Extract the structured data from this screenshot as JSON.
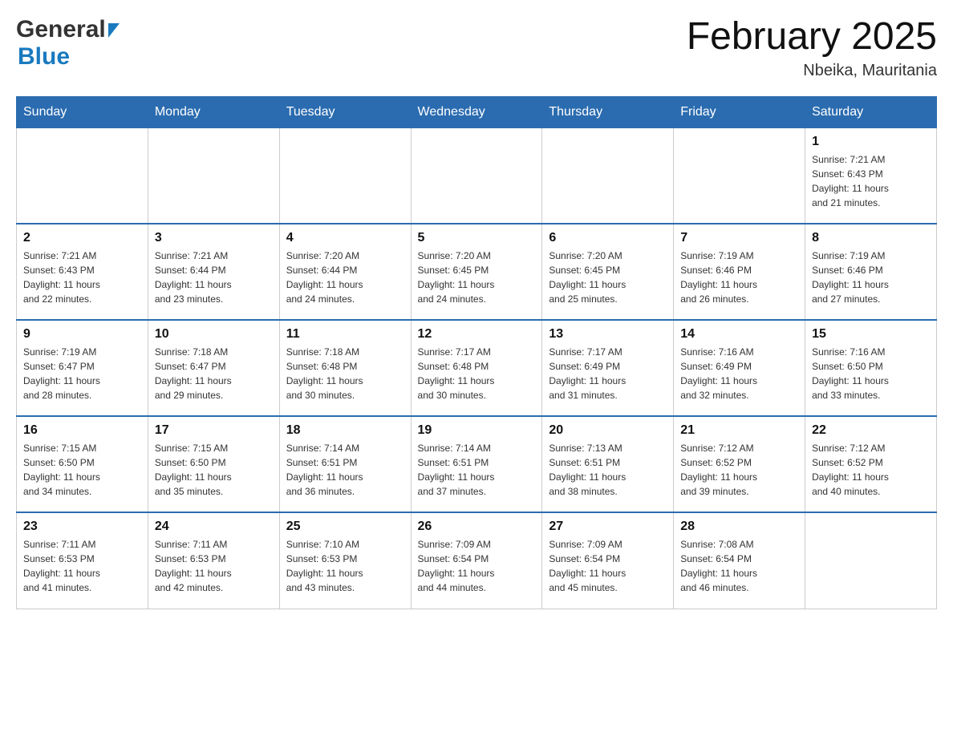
{
  "header": {
    "logo": {
      "general_text": "General",
      "blue_text": "Blue"
    },
    "title": "February 2025",
    "location": "Nbeika, Mauritania"
  },
  "calendar": {
    "days_of_week": [
      "Sunday",
      "Monday",
      "Tuesday",
      "Wednesday",
      "Thursday",
      "Friday",
      "Saturday"
    ],
    "weeks": [
      {
        "days": [
          {
            "number": "",
            "info": ""
          },
          {
            "number": "",
            "info": ""
          },
          {
            "number": "",
            "info": ""
          },
          {
            "number": "",
            "info": ""
          },
          {
            "number": "",
            "info": ""
          },
          {
            "number": "",
            "info": ""
          },
          {
            "number": "1",
            "info": "Sunrise: 7:21 AM\nSunset: 6:43 PM\nDaylight: 11 hours\nand 21 minutes."
          }
        ]
      },
      {
        "days": [
          {
            "number": "2",
            "info": "Sunrise: 7:21 AM\nSunset: 6:43 PM\nDaylight: 11 hours\nand 22 minutes."
          },
          {
            "number": "3",
            "info": "Sunrise: 7:21 AM\nSunset: 6:44 PM\nDaylight: 11 hours\nand 23 minutes."
          },
          {
            "number": "4",
            "info": "Sunrise: 7:20 AM\nSunset: 6:44 PM\nDaylight: 11 hours\nand 24 minutes."
          },
          {
            "number": "5",
            "info": "Sunrise: 7:20 AM\nSunset: 6:45 PM\nDaylight: 11 hours\nand 24 minutes."
          },
          {
            "number": "6",
            "info": "Sunrise: 7:20 AM\nSunset: 6:45 PM\nDaylight: 11 hours\nand 25 minutes."
          },
          {
            "number": "7",
            "info": "Sunrise: 7:19 AM\nSunset: 6:46 PM\nDaylight: 11 hours\nand 26 minutes."
          },
          {
            "number": "8",
            "info": "Sunrise: 7:19 AM\nSunset: 6:46 PM\nDaylight: 11 hours\nand 27 minutes."
          }
        ]
      },
      {
        "days": [
          {
            "number": "9",
            "info": "Sunrise: 7:19 AM\nSunset: 6:47 PM\nDaylight: 11 hours\nand 28 minutes."
          },
          {
            "number": "10",
            "info": "Sunrise: 7:18 AM\nSunset: 6:47 PM\nDaylight: 11 hours\nand 29 minutes."
          },
          {
            "number": "11",
            "info": "Sunrise: 7:18 AM\nSunset: 6:48 PM\nDaylight: 11 hours\nand 30 minutes."
          },
          {
            "number": "12",
            "info": "Sunrise: 7:17 AM\nSunset: 6:48 PM\nDaylight: 11 hours\nand 30 minutes."
          },
          {
            "number": "13",
            "info": "Sunrise: 7:17 AM\nSunset: 6:49 PM\nDaylight: 11 hours\nand 31 minutes."
          },
          {
            "number": "14",
            "info": "Sunrise: 7:16 AM\nSunset: 6:49 PM\nDaylight: 11 hours\nand 32 minutes."
          },
          {
            "number": "15",
            "info": "Sunrise: 7:16 AM\nSunset: 6:50 PM\nDaylight: 11 hours\nand 33 minutes."
          }
        ]
      },
      {
        "days": [
          {
            "number": "16",
            "info": "Sunrise: 7:15 AM\nSunset: 6:50 PM\nDaylight: 11 hours\nand 34 minutes."
          },
          {
            "number": "17",
            "info": "Sunrise: 7:15 AM\nSunset: 6:50 PM\nDaylight: 11 hours\nand 35 minutes."
          },
          {
            "number": "18",
            "info": "Sunrise: 7:14 AM\nSunset: 6:51 PM\nDaylight: 11 hours\nand 36 minutes."
          },
          {
            "number": "19",
            "info": "Sunrise: 7:14 AM\nSunset: 6:51 PM\nDaylight: 11 hours\nand 37 minutes."
          },
          {
            "number": "20",
            "info": "Sunrise: 7:13 AM\nSunset: 6:51 PM\nDaylight: 11 hours\nand 38 minutes."
          },
          {
            "number": "21",
            "info": "Sunrise: 7:12 AM\nSunset: 6:52 PM\nDaylight: 11 hours\nand 39 minutes."
          },
          {
            "number": "22",
            "info": "Sunrise: 7:12 AM\nSunset: 6:52 PM\nDaylight: 11 hours\nand 40 minutes."
          }
        ]
      },
      {
        "days": [
          {
            "number": "23",
            "info": "Sunrise: 7:11 AM\nSunset: 6:53 PM\nDaylight: 11 hours\nand 41 minutes."
          },
          {
            "number": "24",
            "info": "Sunrise: 7:11 AM\nSunset: 6:53 PM\nDaylight: 11 hours\nand 42 minutes."
          },
          {
            "number": "25",
            "info": "Sunrise: 7:10 AM\nSunset: 6:53 PM\nDaylight: 11 hours\nand 43 minutes."
          },
          {
            "number": "26",
            "info": "Sunrise: 7:09 AM\nSunset: 6:54 PM\nDaylight: 11 hours\nand 44 minutes."
          },
          {
            "number": "27",
            "info": "Sunrise: 7:09 AM\nSunset: 6:54 PM\nDaylight: 11 hours\nand 45 minutes."
          },
          {
            "number": "28",
            "info": "Sunrise: 7:08 AM\nSunset: 6:54 PM\nDaylight: 11 hours\nand 46 minutes."
          },
          {
            "number": "",
            "info": ""
          }
        ]
      }
    ]
  }
}
